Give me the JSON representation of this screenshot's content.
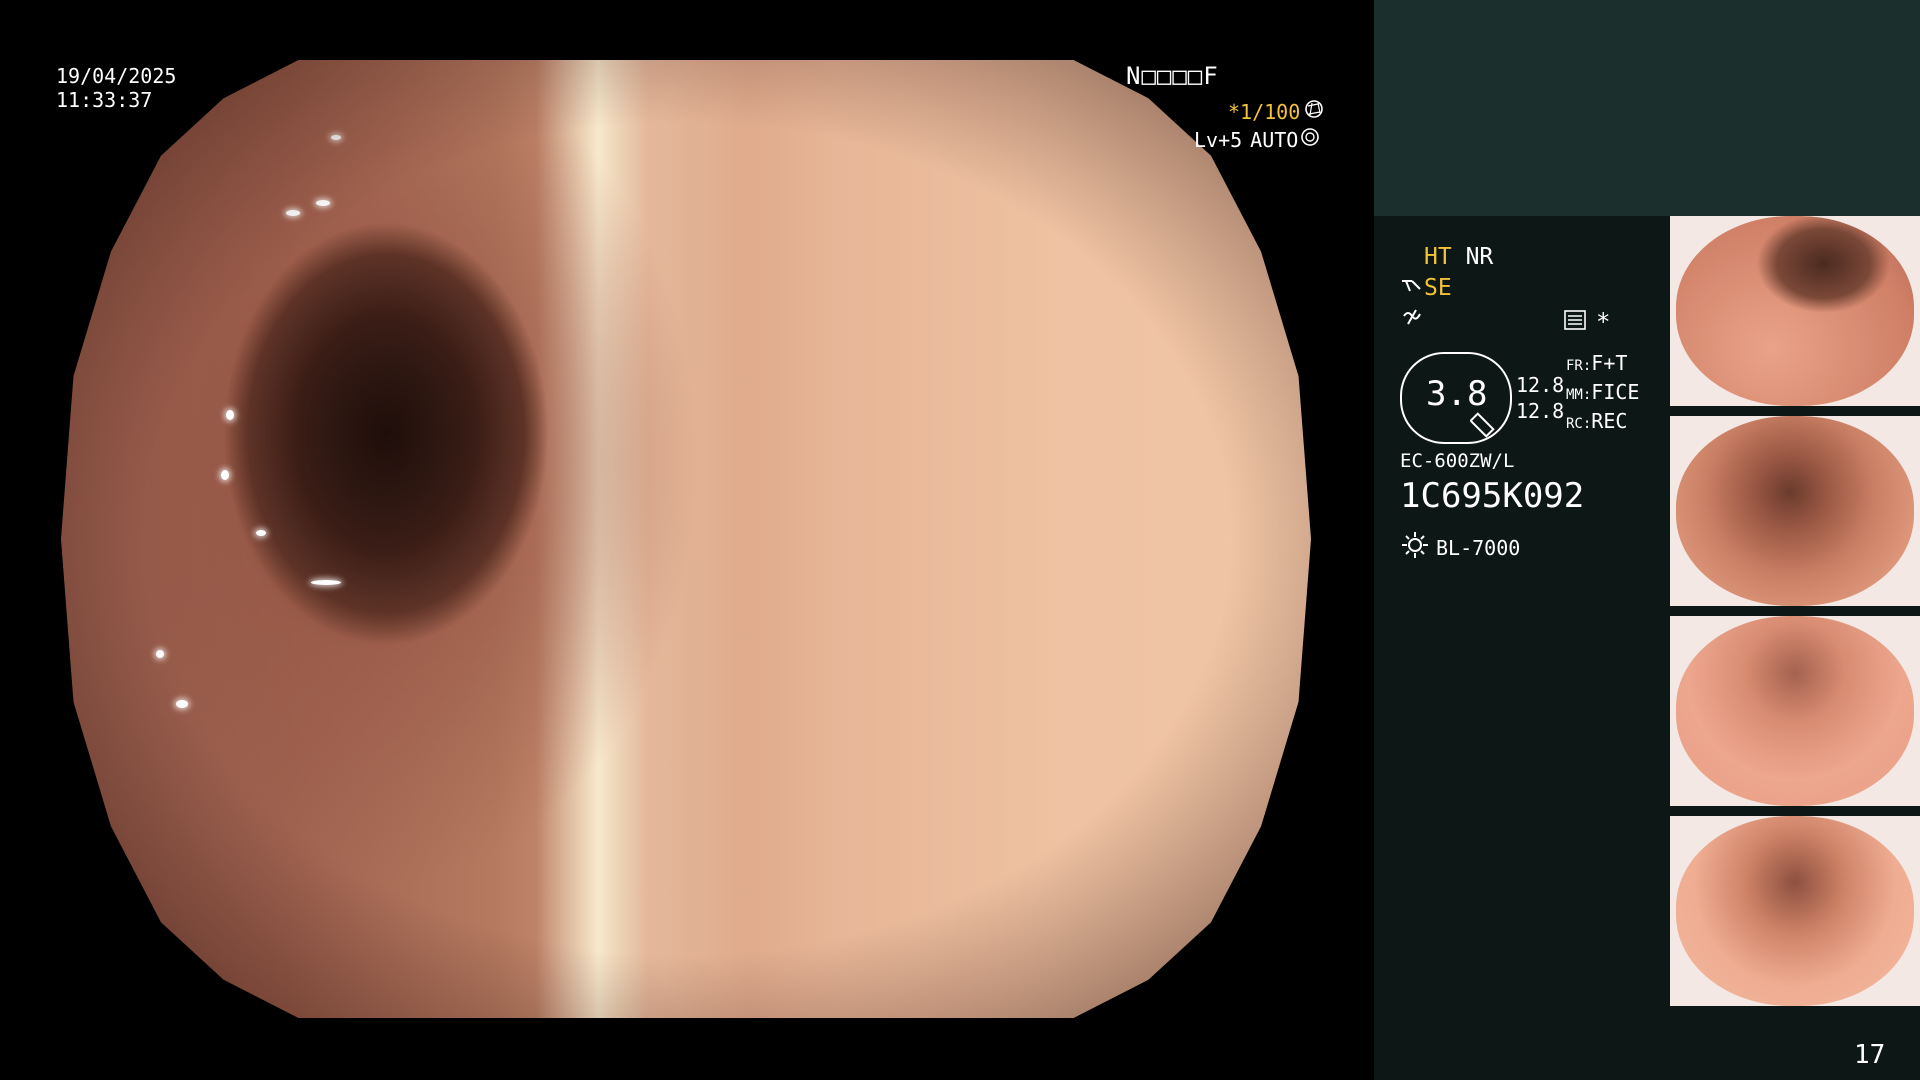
{
  "overlay": {
    "date": "19/04/2025",
    "time": "11:33:37",
    "patient_code": "N□□□□F",
    "shutter": "*1/100",
    "level": "Lv+5",
    "auto_label": "AUTO"
  },
  "sidebar": {
    "ht_label": "HT",
    "nr_label": "NR",
    "se_label": "SE",
    "asterisk": "*",
    "gauge_value": "3.8",
    "value_fr": "12.8",
    "value_mm": "12.8",
    "fr_label": "FR:",
    "fr_value": "F+T",
    "mm_label": "MM:",
    "mm_value": "FICE",
    "rc_label": "RC:",
    "rc_value": "REC",
    "scope_model": "EC-600ZW/L",
    "serial": "1C695K092",
    "light_source": "BL-7000",
    "image_count": "17"
  },
  "colors": {
    "sidebar_top": "#1b302d",
    "sidebar_bottom": "#0d1816",
    "accent_yellow": "#f3c13a"
  },
  "icons": [
    "aperture-icon",
    "iris-icon",
    "scope-icon",
    "wave-icon",
    "menu-icon",
    "zoom-icon",
    "light-icon"
  ]
}
